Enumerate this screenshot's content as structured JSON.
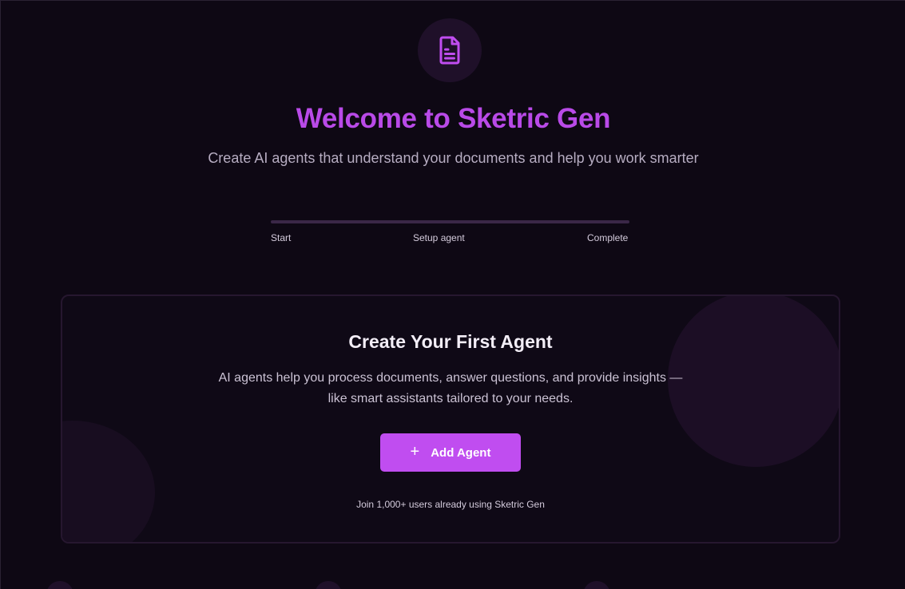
{
  "header": {
    "icon": "document-icon",
    "title": "Welcome to Sketric Gen",
    "subtitle": "Create AI agents that understand your documents and help you work smarter"
  },
  "progress": {
    "value": 0,
    "steps": [
      "Start",
      "Setup agent",
      "Complete"
    ]
  },
  "card": {
    "title": "Create Your First Agent",
    "description_line1": "AI agents help you process documents, answer questions, and provide insights —",
    "description_line2": "like smart assistants tailored to your needs.",
    "button_label": "Add Agent",
    "button_icon": "plus-icon",
    "footer": "Join 1,000+ users already using Sketric Gen"
  },
  "colors": {
    "accent": "#c04df0",
    "title": "#b94ae8",
    "background": "#0e0814"
  }
}
